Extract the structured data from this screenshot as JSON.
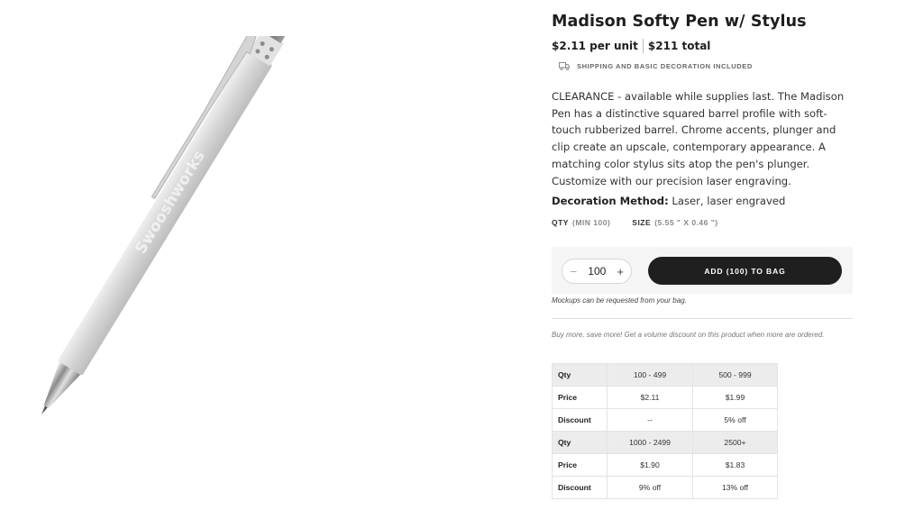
{
  "product": {
    "title": "Madison Softy Pen w/ Stylus",
    "unit_price": "$2.11 per unit",
    "total_price": "$211 total",
    "shipping_note": "SHIPPING AND BASIC DECORATION INCLUDED",
    "description": "CLEARANCE - available while supplies last. The Madison Pen has a distinctive squared barrel profile with soft-touch rubberized barrel. Chrome accents, plunger and clip create an upscale, contemporary appearance. A matching color stylus sits atop the pen's plunger. Customize with our precision laser engraving.",
    "decoration_label": "Decoration Method:",
    "decoration_value": " Laser, laser engraved",
    "pen_imprint": "Swooshworks"
  },
  "order": {
    "qty_label": "QTY",
    "qty_min": "(MIN 100)",
    "size_label": "SIZE",
    "size_value": "(5.55 \" X 0.46 \")",
    "quantity": "100",
    "minus": "−",
    "plus": "+",
    "add_button": "ADD (100) TO BAG",
    "mockups_note": "Mockups can be requested from your bag."
  },
  "volume": {
    "note": "Buy more, save more! Get a volume discount on this product when more are ordered.",
    "tiers": [
      {
        "qty_label": "Qty",
        "qty": [
          "100 - 499",
          "500 - 999"
        ],
        "price_label": "Price",
        "price": [
          "$2.11",
          "$1.99"
        ],
        "discount_label": "Discount",
        "discount": [
          "--",
          "5% off"
        ]
      },
      {
        "qty_label": "Qty",
        "qty": [
          "1000 - 2499",
          "2500+"
        ],
        "price_label": "Price",
        "price": [
          "$1.90",
          "$1.83"
        ],
        "discount_label": "Discount",
        "discount": [
          "9% off",
          "13% off"
        ]
      }
    ]
  },
  "icons": {
    "shipping": "truck-icon"
  }
}
